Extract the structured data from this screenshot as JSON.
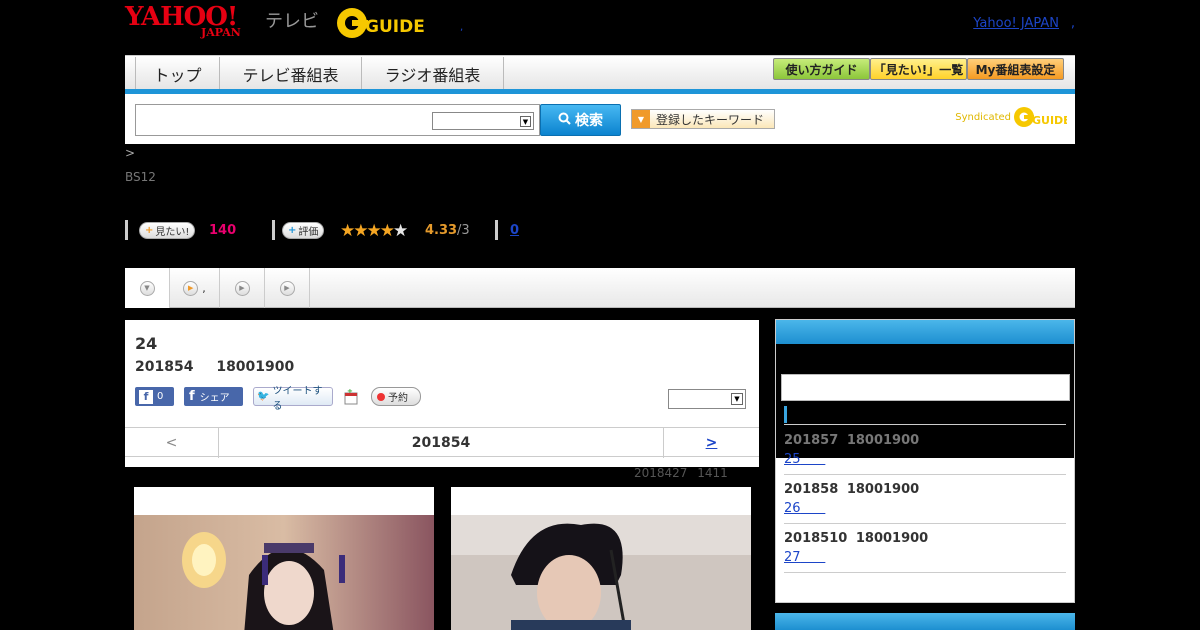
{
  "header": {
    "logo_yahoo": "YAHOO!",
    "logo_japan": "JAPAN",
    "logo_tv": "テレビ",
    "logo_gguide": "G GUIDE",
    "yahoo_link": "Yahoo! JAPAN",
    "yahoo_link_sep": ",",
    "small_dot": ","
  },
  "nav": {
    "tabs": [
      {
        "label": "トップ"
      },
      {
        "label": "テレビ番組表"
      },
      {
        "label": "ラジオ番組表"
      }
    ],
    "buttons": [
      {
        "label": "使い方ガイド",
        "color": "#9fd23d"
      },
      {
        "label": "「見たい!」一覧",
        "color": "#ffd93b"
      },
      {
        "label": "My番組表設定",
        "color": "#f5a030"
      }
    ],
    "accent": "#1e95d8"
  },
  "search": {
    "query": "",
    "select_value": "",
    "button_label": "検索",
    "keyword_button": "登録したキーワード",
    "syndicated": "Syndicated",
    "syndicated_logo": "G GUIDE"
  },
  "breadcrumb": ">",
  "channel": "BS12",
  "actions": {
    "want_label": "見たい!",
    "want_count": "140",
    "rate_label": "評価",
    "rating": "4.33",
    "rating_of": "/3",
    "comments": "0",
    "star_color": "#f5a623"
  },
  "subtabs": [
    {
      "label": "",
      "icon": "down"
    },
    {
      "label": ",",
      "icon": "play-orange"
    },
    {
      "label": "",
      "icon": "play"
    },
    {
      "label": "",
      "icon": "play"
    }
  ],
  "program": {
    "episode": "24",
    "date": "201854",
    "time": "18001900",
    "fb_like_count": "0",
    "fb_share": "シェア",
    "tweet": "ツイートする",
    "reserve": "予約",
    "select_value": "",
    "pager_prev": "<",
    "pager_current": "201854",
    "pager_next": ">",
    "updated_date": "2018427",
    "updated_time": "1411"
  },
  "sidebar": {
    "items": [
      {
        "date": "201857",
        "time": "18001900",
        "link": "25"
      },
      {
        "date": "201858",
        "time": "18001900",
        "link": "26"
      },
      {
        "date": "2018510",
        "time": "18001900",
        "link": "27"
      }
    ]
  }
}
